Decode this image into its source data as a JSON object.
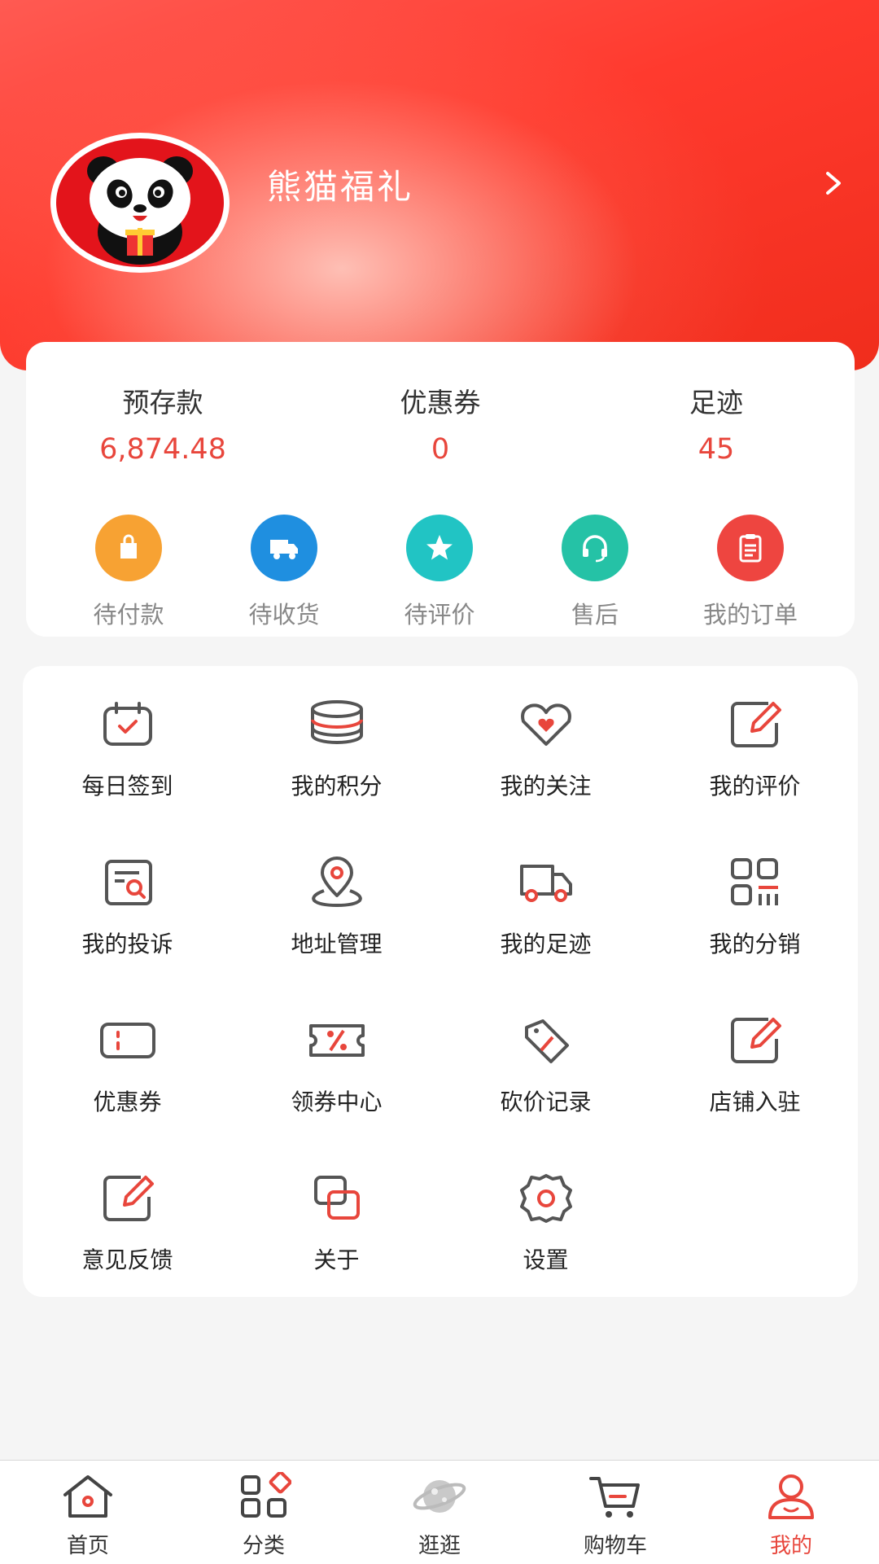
{
  "profile": {
    "name": "熊猫福礼"
  },
  "stats": [
    {
      "label": "预存款",
      "value": "6,874.48"
    },
    {
      "label": "优惠券",
      "value": "0"
    },
    {
      "label": "足迹",
      "value": "45"
    }
  ],
  "orders": [
    {
      "label": "待付款",
      "icon": "shopping-bag-icon",
      "color": "#f7a233"
    },
    {
      "label": "待收货",
      "icon": "truck-icon",
      "color": "#1f8fe0"
    },
    {
      "label": "待评价",
      "icon": "star-icon",
      "color": "#21c4c4"
    },
    {
      "label": "售后",
      "icon": "headset-icon",
      "color": "#25c2a6"
    },
    {
      "label": "我的订单",
      "icon": "clipboard-icon",
      "color": "#ee4540"
    }
  ],
  "menu": [
    {
      "label": "每日签到",
      "icon": "calendar-check-icon"
    },
    {
      "label": "我的积分",
      "icon": "coin-stack-icon"
    },
    {
      "label": "我的关注",
      "icon": "heart-icon"
    },
    {
      "label": "我的评价",
      "icon": "edit-icon"
    },
    {
      "label": "我的投诉",
      "icon": "complaint-search-icon"
    },
    {
      "label": "地址管理",
      "icon": "location-pin-icon"
    },
    {
      "label": "我的足迹",
      "icon": "truck-icon"
    },
    {
      "label": "我的分销",
      "icon": "grid-chart-icon"
    },
    {
      "label": "优惠券",
      "icon": "ticket-icon"
    },
    {
      "label": "领券中心",
      "icon": "coupon-percent-icon"
    },
    {
      "label": "砍价记录",
      "icon": "price-tag-icon"
    },
    {
      "label": "店铺入驻",
      "icon": "edit-icon"
    },
    {
      "label": "意见反馈",
      "icon": "edit-icon"
    },
    {
      "label": "关于",
      "icon": "overlap-squares-icon"
    },
    {
      "label": "设置",
      "icon": "gear-icon"
    }
  ],
  "tabs": [
    {
      "label": "首页",
      "icon": "home-icon"
    },
    {
      "label": "分类",
      "icon": "category-icon"
    },
    {
      "label": "逛逛",
      "icon": "planet-icon"
    },
    {
      "label": "购物车",
      "icon": "cart-icon"
    },
    {
      "label": "我的",
      "icon": "user-icon",
      "active": true
    }
  ],
  "colors": {
    "accent": "#e8463c",
    "header": "#f53b2f",
    "icon_gray": "#555555"
  }
}
